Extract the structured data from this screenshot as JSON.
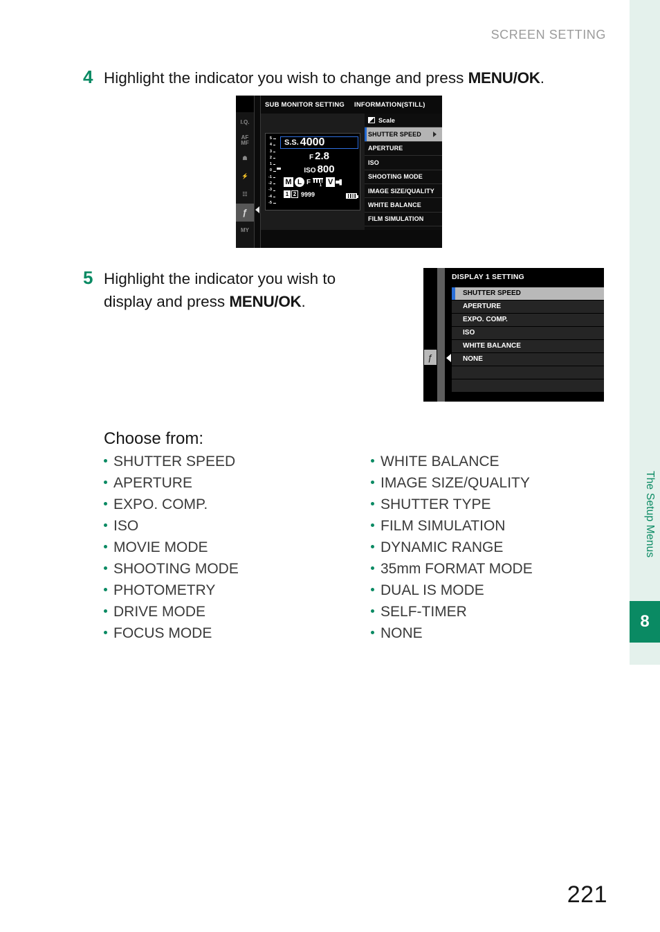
{
  "page": {
    "running_head": "SCREEN SETTING",
    "page_number": "221",
    "side_tab_label": "The Setup Menus",
    "side_tab_number": "8",
    "accent_green": "#0a8a63",
    "head_gray": "#9b9b9b"
  },
  "steps": [
    {
      "number": "4",
      "text_before": "Highlight the indicator you wish to change and press ",
      "text_bold": "MENU/OK",
      "text_after": "."
    },
    {
      "number": "5",
      "line1": "Highlight the indicator you wish to",
      "line2_before": "display and press ",
      "line2_bold": "MENU/OK",
      "line2_after": "."
    }
  ],
  "choose": {
    "heading": "Choose from:",
    "left_column": [
      "SHUTTER SPEED",
      "APERTURE",
      "EXPO. COMP.",
      "ISO",
      "MOVIE MODE",
      "SHOOTING MODE",
      "PHOTOMETRY",
      "DRIVE MODE",
      "FOCUS MODE"
    ],
    "right_column": [
      "WHITE BALANCE",
      "IMAGE SIZE/QUALITY",
      "SHUTTER TYPE",
      "FILM SIMULATION",
      "DYNAMIC RANGE",
      "35mm FORMAT MODE",
      "DUAL IS MODE",
      "SELF-TIMER",
      "NONE"
    ]
  },
  "camera_screen_1": {
    "title_left": "SUB MONITOR SETTING",
    "title_right": "INFORMATION(STILL)",
    "rail_icons": [
      {
        "name": "image-quality-icon",
        "label": "I.Q."
      },
      {
        "name": "af-mf-icon",
        "label": "AF\nMF"
      },
      {
        "name": "shooting-setting-icon",
        "label": "☗"
      },
      {
        "name": "flash-setting-icon",
        "label": "⚡"
      },
      {
        "name": "movie-setting-icon",
        "label": "☷"
      },
      {
        "name": "setup-wrench-icon",
        "label": "ƒ",
        "active": true
      },
      {
        "name": "my-menu-icon",
        "label": "MY"
      }
    ],
    "menu_items": [
      {
        "label": "Scale",
        "icon": "scale-icon",
        "selected": false
      },
      {
        "label": "SHUTTER SPEED",
        "selected": true,
        "has_arrow": true
      },
      {
        "label": "APERTURE",
        "selected": false
      },
      {
        "label": "ISO",
        "selected": false
      },
      {
        "label": "SHOOTING MODE",
        "selected": false
      },
      {
        "label": "IMAGE SIZE/QUALITY",
        "selected": false
      },
      {
        "label": "WHITE BALANCE",
        "selected": false
      },
      {
        "label": "FILM SIMULATION",
        "selected": false
      }
    ],
    "lcd_preview": {
      "exposure_scale": [
        "5",
        "4",
        "3",
        "2",
        "1",
        "0",
        "-1",
        "-2",
        "-3",
        "-4",
        "-5"
      ],
      "shutter_label": "S.S.",
      "shutter_value": "4000",
      "aperture_label": "F",
      "aperture_value": "2.8",
      "iso_label": "ISO",
      "iso_value": "800",
      "mode_badge": "M",
      "size_badge": "L",
      "quality_label": "F",
      "drive_number": "1",
      "film_badge": "V",
      "slot1": "1",
      "slot2": "2",
      "frames_remaining": "9999"
    }
  },
  "camera_screen_2": {
    "title": "DISPLAY 1 SETTING",
    "items": [
      {
        "label": "SHUTTER SPEED",
        "selected": true
      },
      {
        "label": "APERTURE",
        "selected": false
      },
      {
        "label": "EXPO. COMP.",
        "selected": false
      },
      {
        "label": "ISO",
        "selected": false
      },
      {
        "label": "WHITE BALANCE",
        "selected": false
      },
      {
        "label": "NONE",
        "selected": false
      },
      {
        "label": "",
        "selected": false
      },
      {
        "label": "",
        "selected": false
      }
    ]
  }
}
